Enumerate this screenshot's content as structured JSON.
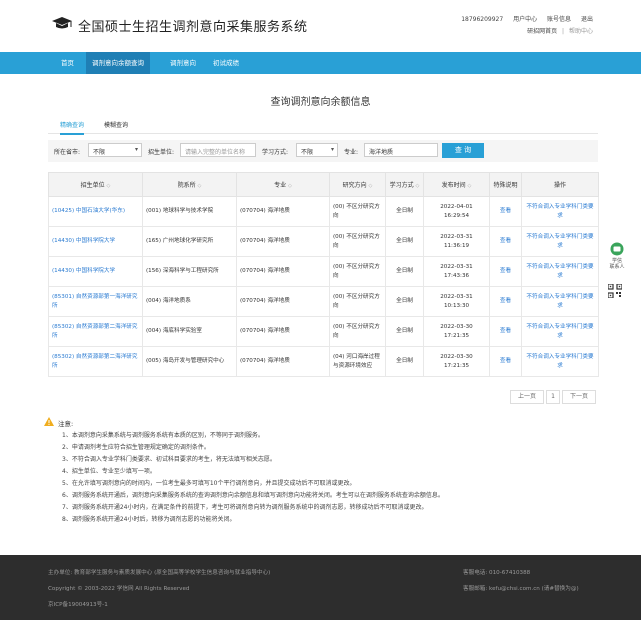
{
  "header": {
    "site_title": "全国硕士生招生调剂意向采集服务系统",
    "phone": "18796209927",
    "user_center": "用户中心",
    "account_info": "账号信息",
    "logout": "退出",
    "home_link": "研招网首页",
    "help_center": "帮助中心",
    "separator": "|"
  },
  "nav": {
    "items": [
      {
        "label": "首页",
        "active": false
      },
      {
        "label": "调剂意向余额查询",
        "active": true
      },
      {
        "label": "调剂意向",
        "active": false
      },
      {
        "label": "初试成绩",
        "active": false
      }
    ]
  },
  "main": {
    "title": "查询调剂意向余额信息",
    "tabs": [
      {
        "label": "精确查询",
        "active": true
      },
      {
        "label": "模糊查询",
        "active": false
      }
    ]
  },
  "filters": {
    "city_label": "所在省市:",
    "city_value": "不限",
    "unit_label": "招生单位:",
    "unit_placeholder": "请输入完整的单位名称",
    "mode_label": "学习方式:",
    "mode_value": "不限",
    "major_label": "专业:",
    "major_value": "海洋地质",
    "query_button": "查 询"
  },
  "table": {
    "headers": [
      "招生单位",
      "院系所",
      "专业",
      "研究方向",
      "学习方式",
      "发布时间",
      "特殊说明",
      "操作"
    ],
    "sort_mark": "◇",
    "rows": [
      {
        "unit": "(10425) 中国石油大学(华东)",
        "dept": "(001) 地球科学与技术学院",
        "major": "(070704) 海洋地质",
        "direction": "(00) 不区分研究方向",
        "mode": "全日制",
        "time": "2022-04-01 16:29:54",
        "note": "查看",
        "action": "不符合调入专业学科门类要求"
      },
      {
        "unit": "(14430) 中国科学院大学",
        "dept": "(165) 广州地球化学研究所",
        "major": "(070704) 海洋地质",
        "direction": "(00) 不区分研究方向",
        "mode": "全日制",
        "time": "2022-03-31 11:36:19",
        "note": "查看",
        "action": "不符合调入专业学科门类要求"
      },
      {
        "unit": "(14430) 中国科学院大学",
        "dept": "(156) 深海科学与工程研究所",
        "major": "(070704) 海洋地质",
        "direction": "(00) 不区分研究方向",
        "mode": "全日制",
        "time": "2022-03-31 17:43:36",
        "note": "查看",
        "action": "不符合调入专业学科门类要求"
      },
      {
        "unit": "(85301) 自然资源部第一海洋研究所",
        "dept": "(004) 海洋地质系",
        "major": "(070704) 海洋地质",
        "direction": "(00) 不区分研究方向",
        "mode": "全日制",
        "time": "2022-03-31 10:13:30",
        "note": "查看",
        "action": "不符合调入专业学科门类要求"
      },
      {
        "unit": "(85302) 自然资源部第二海洋研究所",
        "dept": "(004) 海底科学实验室",
        "major": "(070704) 海洋地质",
        "direction": "(00) 不区分研究方向",
        "mode": "全日制",
        "time": "2022-03-30 17:21:35",
        "note": "查看",
        "action": "不符合调入专业学科门类要求"
      },
      {
        "unit": "(85302) 自然资源部第二海洋研究所",
        "dept": "(005) 海岛开发与管理研究中心",
        "major": "(070704) 海洋地质",
        "direction": "(04) 河口海岸过程与资源环境效应",
        "mode": "全日制",
        "time": "2022-03-30 17:21:35",
        "note": "查看",
        "action": "不符合调入专业学科门类要求"
      }
    ]
  },
  "pager": {
    "prev": "上一页",
    "current": "1",
    "next": "下一页"
  },
  "notice": {
    "title": "注意:",
    "items": [
      "1、本调剂意向采集系统与调剂服务系统有本质的区别，不等同于调剂服务。",
      "2、申请调剂考生应符合招生管理规定确定的调剂条件。",
      "3、不符合调入专业学科门类要求、初试科目要求的考生，将无法填写相关志愿。",
      "4、招生单位、专业至少填写一项。",
      "5、在允许填写调剂意向的时间内，一位考生最多可填写10个平行调剂意向，并且提交成功后不可取消或更改。",
      "6、调剂服务系统开通后，调剂意向采集服务系统的查询调剂意向余额信息和填写调剂意向功能将关闭。考生可以在调剂服务系统查询余额信息。",
      "7、调剂服务系统开通24小时内，在满足条件的前提下，考生可将调剂意向转为调剂服务系统中的调剂志愿，转移成功后不可取消或更改。",
      "8、调剂服务系统开通24小时后，转移为调剂志愿的功能将关闭。"
    ]
  },
  "side": {
    "contact_label": "学信\n联系人",
    "qr_label": "qr"
  },
  "footer": {
    "sponsor": "主办单位: 教育部学生服务与素质发展中心 (原全国高等学校学生信息咨询与就业指导中心)",
    "copyright": "Copyright © 2003-2022 学信网 All Rights Reserved",
    "icp": "京ICP备19004913号-1",
    "phone": "客服电话: 010-67410388",
    "email": "客服邮箱: kefu@chsi.com.cn (请#替换为@)"
  },
  "colors": {
    "accent": "#29a0d6",
    "nav_active": "#1f7fb5",
    "link": "#2a7bd2",
    "footer_bg": "#2d2d2d"
  }
}
